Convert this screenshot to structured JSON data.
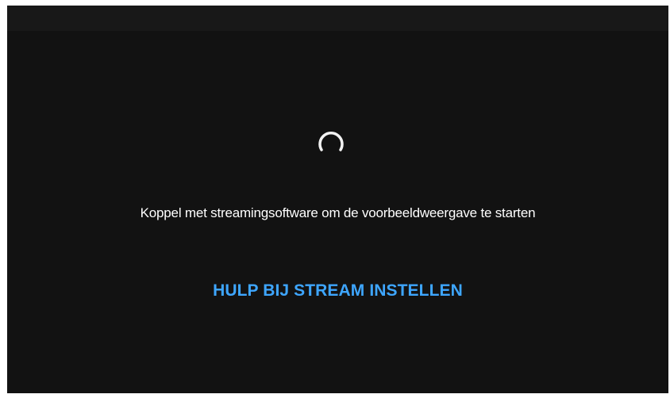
{
  "preview": {
    "loading_icon": "loading-spinner-icon",
    "message": "Koppel met streamingsoftware om de voorbeeldweergave te starten",
    "help_link_label": "HULP BIJ STREAM INSTELLEN"
  },
  "colors": {
    "background": "#121212",
    "top_bar": "#181818",
    "text": "#ffffff",
    "link": "#3ea6ff",
    "spinner": "#ffffff"
  }
}
